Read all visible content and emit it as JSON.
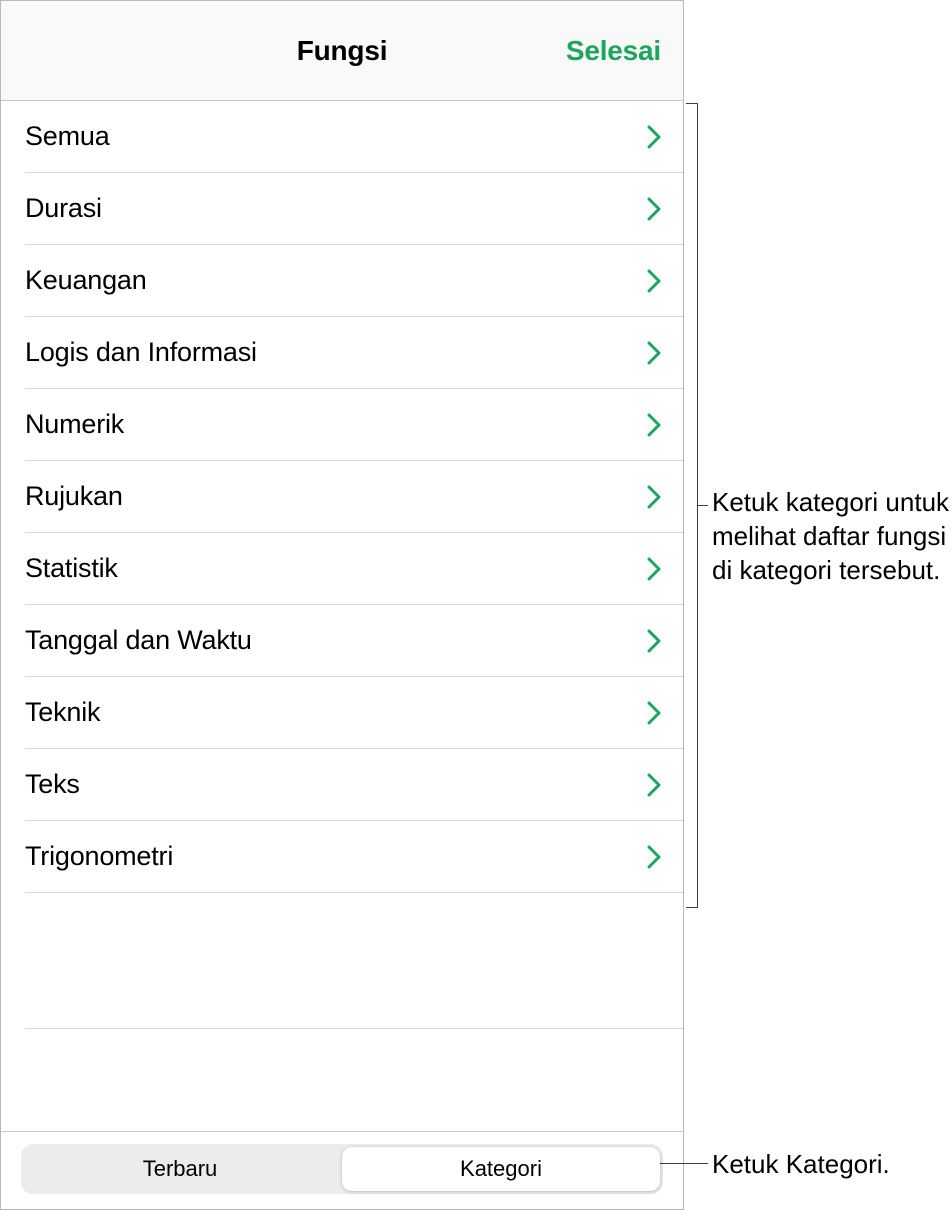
{
  "header": {
    "title": "Fungsi",
    "done": "Selesai"
  },
  "categories": [
    "Semua",
    "Durasi",
    "Keuangan",
    "Logis dan Informasi",
    "Numerik",
    "Rujukan",
    "Statistik",
    "Tanggal dan Waktu",
    "Teknik",
    "Teks",
    "Trigonometri"
  ],
  "segmented": {
    "recent": "Terbaru",
    "category": "Kategori"
  },
  "callouts": {
    "list": "Ketuk kategori untuk melihat daftar fungsi di kategori tersebut.",
    "tab": "Ketuk Kategori."
  },
  "colors": {
    "accent": "#1aa65b"
  }
}
